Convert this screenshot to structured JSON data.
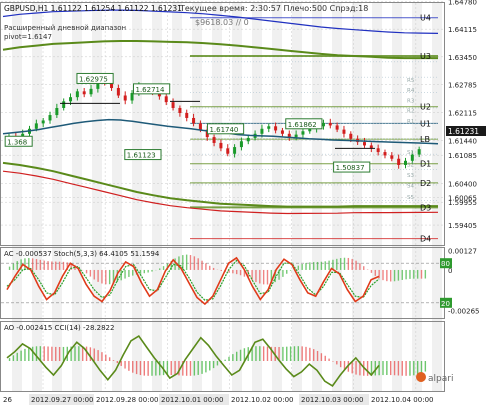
{
  "colors": {
    "background": "#ffffff",
    "grid": "#c8c8c8",
    "shade": "#e6e6e6",
    "candle_up": "#1a9a2a",
    "candle_down": "#d21e1e",
    "ma": "#1e5a78",
    "channel": "#5a8a1a",
    "pivot_upper": "#2030c0",
    "pivot_lower": "#d02020",
    "label_box": "#2e7d32",
    "osc_red": "#e03a1a",
    "osc_green": "#2aa02a",
    "cci_line": "#5a8a1a",
    "hist_red": "#e85050",
    "hist_green": "#3cb43c"
  },
  "header": {
    "symbol_line": "GBPUSD,H1  1.61122 1.61254 1.61122 1.61231",
    "status_line": "Текущее время: 2:30:57 Плечо:500 Спрэд:18",
    "indicator_name": "Расширенный дневной диапазон",
    "pivot_text": "pivot=1.6147",
    "extra_line": "$9618.03   // 0"
  },
  "level_labels": {
    "u4": "U4",
    "u3": "U3",
    "u2": "U2",
    "u1": "U1",
    "lb": "LB",
    "d1": "D1",
    "d2": "D2",
    "d3": "D3",
    "d4": "D4",
    "r1": "R1",
    "r2": "R2",
    "r3": "R3",
    "r4": "R4",
    "r5": "R5",
    "s1": "S1",
    "s2": "S2",
    "s3": "S3",
    "s4": "S4",
    "s5": "S5"
  },
  "annotations": {
    "a1": "1.62975",
    "a2": "1.62714",
    "a3": "1.61740",
    "a4": "1.61862",
    "a5": "1.61123",
    "a6": "1.50837",
    "a7": "1.368"
  },
  "current_price_label": "1.61231",
  "logo_text": "alpari",
  "chart_data": [
    {
      "type": "candlestick",
      "name": "GBPUSD,H1",
      "ylim": [
        1.5895,
        1.6472
      ],
      "y_ticks": [
        "1.64780",
        "1.64115",
        "1.63450",
        "1.62785",
        "1.62115",
        "1.61440",
        "1.61085",
        "1.60400",
        "1.60065",
        "1.59955",
        "1.59405"
      ],
      "x_ticks": [
        "26",
        "2012.09.27 00:00",
        "2012.09.28 00:00",
        "2012.10.01 00:00",
        "2012.10.02 00:00",
        "2012.10.03 00:00",
        "2012.10.04 00:00"
      ],
      "close": [
        1.6154,
        1.6148,
        1.616,
        1.6172,
        1.6185,
        1.6192,
        1.6205,
        1.6222,
        1.6238,
        1.6248,
        1.6262,
        1.6255,
        1.6268,
        1.629,
        1.6284,
        1.627,
        1.6252,
        1.624,
        1.6258,
        1.6275,
        1.6268,
        1.6262,
        1.625,
        1.6236,
        1.6222,
        1.621,
        1.6198,
        1.6185,
        1.617,
        1.6152,
        1.6138,
        1.6125,
        1.6112,
        1.6128,
        1.6142,
        1.615,
        1.616,
        1.6172,
        1.6178,
        1.6168,
        1.616,
        1.6152,
        1.6158,
        1.6166,
        1.6172,
        1.6178,
        1.6186,
        1.618,
        1.617,
        1.616,
        1.6148,
        1.614,
        1.6132,
        1.6125,
        1.6116,
        1.6108,
        1.61,
        1.6085,
        1.6095,
        1.611,
        1.6123
      ],
      "ma": [
        1.616,
        1.6163,
        1.6166,
        1.617,
        1.6175,
        1.618,
        1.6185,
        1.6189,
        1.6192,
        1.6194,
        1.6193,
        1.619,
        1.6186,
        1.6182,
        1.6178,
        1.6175,
        1.6172,
        1.6168,
        1.6165,
        1.6162,
        1.6158,
        1.6156,
        1.6155,
        1.6154,
        1.6152,
        1.615,
        1.6148,
        1.6147,
        1.6145,
        1.6144,
        1.6143,
        1.6142,
        1.6141,
        1.614,
        1.6139,
        1.6138,
        1.6137,
        1.6136
      ],
      "channel_upper": [
        1.6362,
        1.6368,
        1.6372,
        1.6376,
        1.6378,
        1.638,
        1.6382,
        1.6383,
        1.6383,
        1.6382,
        1.6381,
        1.638,
        1.6378,
        1.6375,
        1.6372,
        1.6368,
        1.6364,
        1.636,
        1.6356,
        1.6352,
        1.6349,
        1.6347,
        1.6345,
        1.6343,
        1.6342,
        1.6342,
        1.6342
      ],
      "channel_lower": [
        1.609,
        1.6085,
        1.6078,
        1.607,
        1.606,
        1.605,
        1.604,
        1.603,
        1.602,
        1.6012,
        1.6005,
        1.6,
        1.5996,
        1.5992,
        1.599,
        1.5988,
        1.5986,
        1.5985,
        1.5985,
        1.5985,
        1.5985,
        1.5986,
        1.5986,
        1.5986,
        1.5986,
        1.5986,
        1.5986
      ],
      "pivot_levels": {
        "u4": 1.6439,
        "u3": 1.6347,
        "u2": 1.6225,
        "u1": 1.6185,
        "lb": 1.6147,
        "d1": 1.6088,
        "d2": 1.6042,
        "d3": 1.5983,
        "d4": 1.5908
      }
    },
    {
      "type": "line",
      "name": "AC + Stoch",
      "indicator_text": "AC -0.000537  Stoch(5,3,3) 64.4105 51.1594",
      "ylim": [
        -0.003,
        0.0013
      ],
      "y_ticks": [
        "0.00127",
        "0",
        "-0.00265"
      ],
      "stoch_levels": [
        "80",
        "20"
      ],
      "stoch_main": [
        40,
        60,
        78,
        70,
        45,
        25,
        35,
        60,
        80,
        72,
        48,
        30,
        22,
        38,
        65,
        82,
        75,
        50,
        30,
        40,
        68,
        85,
        72,
        50,
        28,
        18,
        30,
        55,
        80,
        88,
        70,
        45,
        25,
        40,
        70,
        86,
        78,
        55,
        35,
        30,
        52,
        72,
        64,
        40,
        22,
        30,
        55,
        60
      ],
      "stoch_signal": [
        45,
        55,
        70,
        72,
        55,
        35,
        32,
        50,
        72,
        75,
        58,
        40,
        28,
        32,
        55,
        75,
        78,
        60,
        40,
        38,
        58,
        78,
        76,
        58,
        36,
        24,
        26,
        46,
        70,
        84,
        76,
        54,
        34,
        36,
        60,
        80,
        80,
        62,
        42,
        32,
        45,
        66,
        66,
        48,
        30,
        28,
        46,
        56
      ]
    },
    {
      "type": "bar",
      "name": "AO + CCI",
      "indicator_text": "AO -0.002415  CCI(14) -28.2822",
      "cci": [
        20,
        60,
        110,
        80,
        20,
        -40,
        -90,
        -30,
        60,
        120,
        80,
        10,
        -60,
        -120,
        -60,
        40,
        130,
        160,
        90,
        20,
        -40,
        -110,
        -80,
        10,
        80,
        150,
        100,
        30,
        -30,
        -90,
        -60,
        30,
        120,
        140,
        80,
        10,
        -50,
        -100,
        -70,
        -20,
        -60,
        -130,
        -160,
        -90,
        -30,
        20,
        -40,
        -90,
        -28
      ]
    }
  ]
}
